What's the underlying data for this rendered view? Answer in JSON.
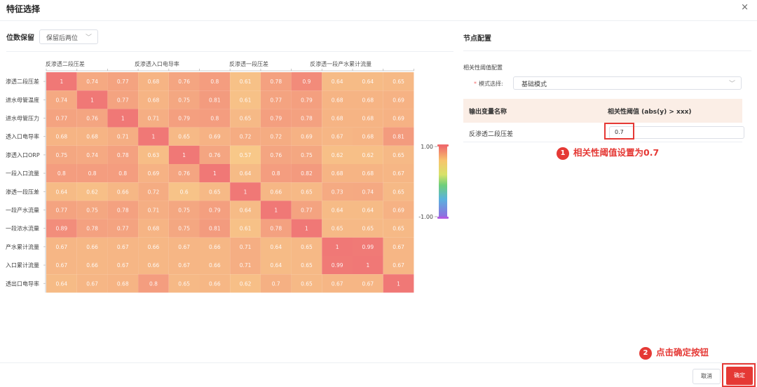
{
  "dialog": {
    "title": "特征选择",
    "close_glyph": "×"
  },
  "precision": {
    "label": "位数保留",
    "value": "保留后两位",
    "chevron": "﹀"
  },
  "chart_data": {
    "type": "heatmap",
    "x_labels_shown": [
      "反渗透二段压差",
      "反渗透入口电导率",
      "反渗透一段压差",
      "反渗透一段产水累计流量"
    ],
    "rows": [
      "渗透二段压差",
      "进水母管温度",
      "进水母管压力",
      "透入口电导率",
      "渗透入口ORP",
      "一段入口流量",
      "渗透一段压差",
      "一段产水流量",
      "一段浓水流量",
      "产水累计流量",
      "入口累计流量",
      "透出口电导率"
    ],
    "values": [
      [
        "1",
        "0.74",
        "0.77",
        "0.68",
        "0.76",
        "0.8",
        "0.61",
        "0.78",
        "0.9",
        "0.64",
        "0.64",
        "0.65"
      ],
      [
        "0.74",
        "1",
        "0.77",
        "0.68",
        "0.75",
        "0.81",
        "0.61",
        "0.77",
        "0.79",
        "0.68",
        "0.68",
        "0.69"
      ],
      [
        "0.77",
        "0.76",
        "1",
        "0.71",
        "0.79",
        "0.8",
        "0.65",
        "0.79",
        "0.78",
        "0.68",
        "0.68",
        "0.69"
      ],
      [
        "0.68",
        "0.68",
        "0.71",
        "1",
        "0.65",
        "0.69",
        "0.72",
        "0.72",
        "0.69",
        "0.67",
        "0.68",
        "0.81"
      ],
      [
        "0.75",
        "0.74",
        "0.78",
        "0.63",
        "1",
        "0.76",
        "0.57",
        "0.76",
        "0.75",
        "0.62",
        "0.62",
        "0.65"
      ],
      [
        "0.8",
        "0.8",
        "0.8",
        "0.69",
        "0.76",
        "1",
        "0.64",
        "0.8",
        "0.82",
        "0.68",
        "0.68",
        "0.67"
      ],
      [
        "0.64",
        "0.62",
        "0.66",
        "0.72",
        "0.6",
        "0.65",
        "1",
        "0.66",
        "0.65",
        "0.73",
        "0.74",
        "0.65"
      ],
      [
        "0.77",
        "0.75",
        "0.78",
        "0.71",
        "0.75",
        "0.79",
        "0.64",
        "1",
        "0.77",
        "0.64",
        "0.64",
        "0.69"
      ],
      [
        "0.89",
        "0.78",
        "0.77",
        "0.68",
        "0.75",
        "0.81",
        "0.61",
        "0.78",
        "1",
        "0.65",
        "0.65",
        "0.65"
      ],
      [
        "0.67",
        "0.66",
        "0.67",
        "0.66",
        "0.67",
        "0.66",
        "0.71",
        "0.64",
        "0.65",
        "1",
        "0.99",
        "0.67"
      ],
      [
        "0.67",
        "0.66",
        "0.67",
        "0.66",
        "0.67",
        "0.66",
        "0.71",
        "0.64",
        "0.65",
        "0.99",
        "1",
        "0.67"
      ],
      [
        "0.64",
        "0.67",
        "0.68",
        "0.8",
        "0.65",
        "0.66",
        "0.62",
        "0.7",
        "0.65",
        "0.67",
        "0.67",
        "1"
      ]
    ],
    "legend": {
      "max_label": "1.00",
      "min_label": "-1.00",
      "range": [
        -1,
        1
      ]
    }
  },
  "node_config": {
    "title": "节点配置",
    "corr_title": "相关性阈值配置",
    "mode_required": "*",
    "mode_label": "模式选择:",
    "mode_value": "基础模式",
    "table": {
      "col1": "输出变量名称",
      "col2": "相关性阈值 (abs(y) > xxx)",
      "rows": [
        {
          "name": "反渗透二段压差",
          "threshold": "0.7"
        }
      ]
    }
  },
  "annotations": {
    "step1": {
      "num": "1",
      "text": "相关性阈值设置为0.7"
    },
    "step2": {
      "num": "2",
      "text": "点击确定按钮"
    }
  },
  "footer": {
    "cancel_label": "取消",
    "ok_label": "确定"
  },
  "colors": {
    "accent": "#e53935",
    "cell_high": "#f0877a",
    "cell_low": "#f7c985",
    "header_row_bg": "#fbeee6"
  }
}
